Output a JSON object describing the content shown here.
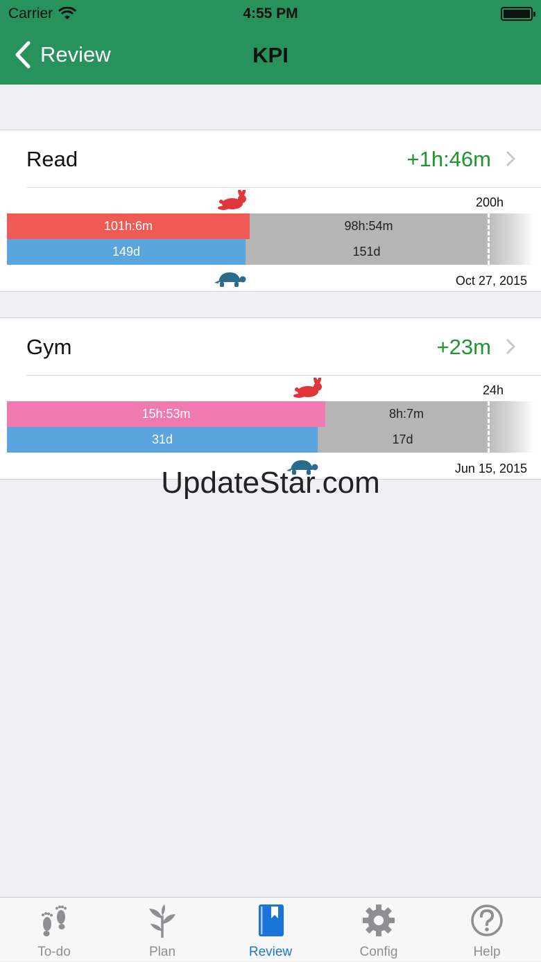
{
  "status_bar": {
    "carrier": "Carrier",
    "time": "4:55 PM"
  },
  "nav": {
    "back_label": "Review",
    "title": "KPI"
  },
  "kpis": [
    {
      "name": "Read",
      "delta": "+1h:46m",
      "target": "200h",
      "date": "Oct 27, 2015",
      "time_done": "101h:6m",
      "time_left": "98h:54m",
      "time_fraction": 0.5055,
      "days_done": "149d",
      "days_left": "151d",
      "days_fraction": 0.4967,
      "time_color": "#f05a55",
      "days_color": "#5aa5dd"
    },
    {
      "name": "Gym",
      "delta": "+23m",
      "target": "24h",
      "date": "Jun 15, 2015",
      "time_done": "15h:53m",
      "time_left": "8h:7m",
      "time_fraction": 0.6618,
      "days_done": "31d",
      "days_left": "17d",
      "days_fraction": 0.6458,
      "time_color": "#f07ab0",
      "days_color": "#5aa5dd"
    }
  ],
  "watermark": "UpdateStar.com",
  "tabs": [
    {
      "label": "To-do",
      "icon": "footprints-icon",
      "active": false
    },
    {
      "label": "Plan",
      "icon": "plant-icon",
      "active": false
    },
    {
      "label": "Review",
      "icon": "book-icon",
      "active": true
    },
    {
      "label": "Config",
      "icon": "gear-icon",
      "active": false
    },
    {
      "label": "Help",
      "icon": "question-icon",
      "active": false
    }
  ],
  "colors": {
    "header": "#27925b",
    "delta_positive": "#1e9630",
    "tab_active": "#1b74d8",
    "tab_inactive": "#8e8e93",
    "rabbit": "#e0353a",
    "turtle": "#2a6c8c"
  }
}
